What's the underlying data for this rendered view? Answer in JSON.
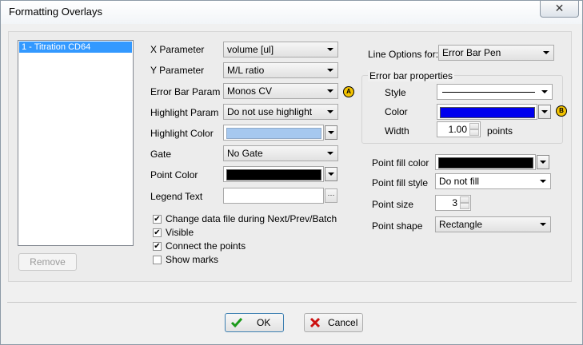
{
  "window": {
    "title": "Formatting Overlays",
    "close_symbol": "✕"
  },
  "list": {
    "items": [
      "1 - Titration CD64"
    ],
    "remove_label": "Remove"
  },
  "params": {
    "x_label": "X Parameter",
    "x_value": "volume [ul]",
    "y_label": "Y Parameter",
    "y_value": "M/L ratio",
    "errbar_label": "Error Bar Param",
    "errbar_value": "Monos CV",
    "errbar_badge": "A",
    "highlight_label": "Highlight Param",
    "highlight_value": "Do not use highlight",
    "hcolor_label": "Highlight Color",
    "hcolor_value": "#a6c8ef",
    "gate_label": "Gate",
    "gate_value": "No Gate",
    "pcolor_label": "Point Color",
    "pcolor_value": "#000000",
    "legend_label": "Legend Text",
    "legend_value": "",
    "legend_btn": "···"
  },
  "checkboxes": [
    {
      "label": "Change data file during Next/Prev/Batch",
      "checked": true
    },
    {
      "label": "Visible",
      "checked": true
    },
    {
      "label": "Connect the points",
      "checked": true
    },
    {
      "label": "Show marks",
      "checked": false
    }
  ],
  "line_options": {
    "label": "Line Options for:",
    "value": "Error Bar Pen",
    "group_title": "Error bar properties",
    "style_label": "Style",
    "color_label": "Color",
    "color_value": "#0000ee",
    "color_badge": "B",
    "width_label": "Width",
    "width_value": "1.00",
    "width_unit": "points"
  },
  "point": {
    "fill_color_label": "Point fill color",
    "fill_color_value": "#000000",
    "fill_style_label": "Point fill style",
    "fill_style_value": "Do not fill",
    "size_label": "Point size",
    "size_value": "3",
    "shape_label": "Point shape",
    "shape_value": "Rectangle"
  },
  "footer": {
    "ok_label": "OK",
    "cancel_label": "Cancel"
  }
}
